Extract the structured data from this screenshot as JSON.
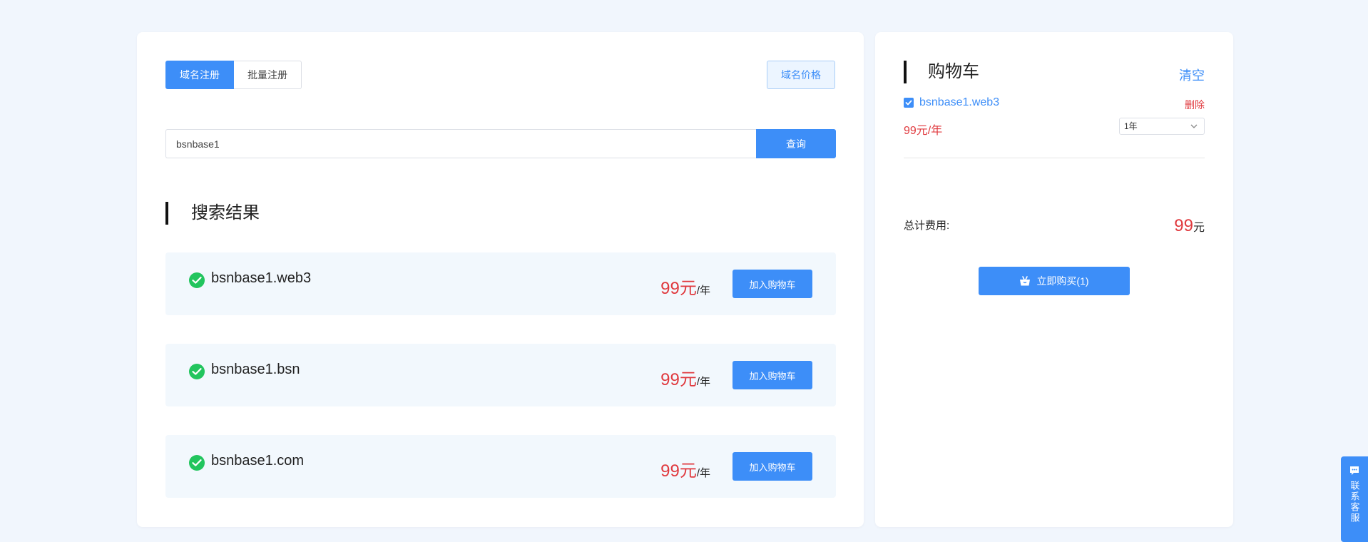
{
  "tabs": [
    {
      "label": "域名注册",
      "active": true
    },
    {
      "label": "批量注册",
      "active": false
    }
  ],
  "price_button": "域名价格",
  "search": {
    "value": "bsnbase1",
    "button": "查询"
  },
  "results_title": "搜索结果",
  "results": [
    {
      "domain": "bsnbase1.web3",
      "price": "99元",
      "unit": "/年",
      "button": "加入购物车"
    },
    {
      "domain": "bsnbase1.bsn",
      "price": "99元",
      "unit": "/年",
      "button": "加入购物车"
    },
    {
      "domain": "bsnbase1.com",
      "price": "99元",
      "unit": "/年",
      "button": "加入购物车"
    }
  ],
  "cart": {
    "title": "购物车",
    "clear": "清空",
    "item": {
      "name": "bsnbase1.web3",
      "checked": true,
      "delete": "删除",
      "price": "99元/年",
      "period": "1年"
    },
    "total_label": "总计费用:",
    "total_value": "99",
    "total_unit": "元",
    "buy_button": "立即购买(1)"
  },
  "float_service": {
    "label": "联系客服"
  },
  "colors": {
    "accent": "#3d8ef8",
    "price": "#e0393e",
    "success": "#22c55e",
    "background": "#f1f6fd"
  }
}
